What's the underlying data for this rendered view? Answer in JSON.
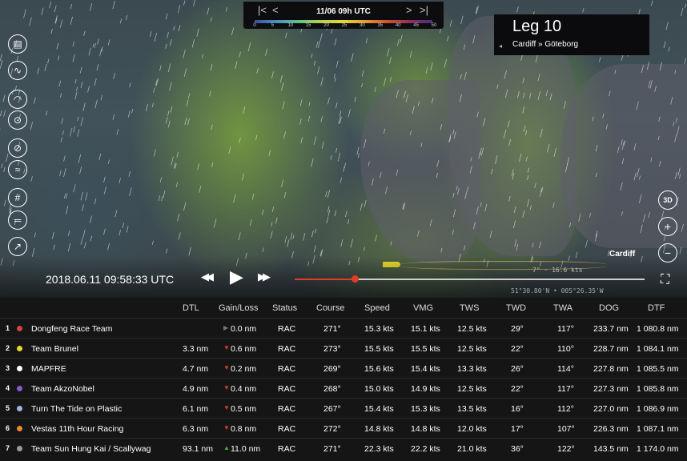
{
  "timebar": {
    "date": "11/06 09h UTC",
    "first": "|<",
    "prev": "<",
    "next": ">",
    "last": ">|",
    "scale": [
      "0",
      "5",
      "10",
      "15",
      "20",
      "25",
      "30",
      "35",
      "40",
      "45",
      "50"
    ]
  },
  "leg": {
    "title": "Leg 10",
    "route": "Cardiff » Göteborg",
    "arrow": "◂"
  },
  "clock": "2018.06.11 09:58:33 UTC",
  "controls": {
    "rewind": "◀◀",
    "play": "▶",
    "forward": "▶▶"
  },
  "map": {
    "cardiff": "Cardiff",
    "boat_info": "7° · 16.6 kts",
    "coords": "51°30.80'N • 005°26.35'W"
  },
  "tools_left": [
    "map-icon",
    "route-icon",
    "wind-icon",
    "compass-icon",
    "current-icon",
    "wave-icon",
    "grid-icon",
    "ruler-icon",
    "graph-icon"
  ],
  "tools_right": {
    "threed": "3D",
    "zoom_in": "+",
    "zoom_out": "−"
  },
  "table": {
    "headers": [
      "DTL",
      "Gain/Loss",
      "Status",
      "Course",
      "Speed",
      "VMG",
      "TWS",
      "TWD",
      "TWA",
      "DOG",
      "DTF"
    ],
    "rows": [
      {
        "rank": "1",
        "color": "#d0463c",
        "team": "Dongfeng Race Team",
        "dtl": "",
        "gain": "0.0 nm",
        "trend": "flat",
        "status": "RAC",
        "course": "271°",
        "speed": "15.3 kts",
        "vmg": "15.1 kts",
        "tws": "12.5 kts",
        "twd": "29°",
        "twa": "117°",
        "dog": "233.7 nm",
        "dtf": "1 080.8 nm"
      },
      {
        "rank": "2",
        "color": "#e8da2c",
        "team": "Team Brunel",
        "dtl": "3.3 nm",
        "gain": "0.6 nm",
        "trend": "down",
        "status": "RAC",
        "course": "273°",
        "speed": "15.5 kts",
        "vmg": "15.5 kts",
        "tws": "12.5 kts",
        "twd": "22°",
        "twa": "110°",
        "dog": "228.7 nm",
        "dtf": "1 084.1 nm"
      },
      {
        "rank": "3",
        "color": "#ffffff",
        "team": "MAPFRE",
        "dtl": "4.7 nm",
        "gain": "0.2 nm",
        "trend": "down",
        "status": "RAC",
        "course": "269°",
        "speed": "15.6 kts",
        "vmg": "15.4 kts",
        "tws": "13.3 kts",
        "twd": "26°",
        "twa": "114°",
        "dog": "227.8 nm",
        "dtf": "1 085.5 nm"
      },
      {
        "rank": "4",
        "color": "#8a5ad0",
        "team": "Team AkzoNobel",
        "dtl": "4.9 nm",
        "gain": "0.4 nm",
        "trend": "down",
        "status": "RAC",
        "course": "268°",
        "speed": "15.0 kts",
        "vmg": "14.9 kts",
        "tws": "12.5 kts",
        "twd": "22°",
        "twa": "117°",
        "dog": "227.3 nm",
        "dtf": "1 085.8 nm"
      },
      {
        "rank": "5",
        "color": "#a0b4e6",
        "team": "Turn The Tide on Plastic",
        "dtl": "6.1 nm",
        "gain": "0.5 nm",
        "trend": "down",
        "status": "RAC",
        "course": "267°",
        "speed": "15.4 kts",
        "vmg": "15.3 kts",
        "tws": "13.5 kts",
        "twd": "16°",
        "twa": "112°",
        "dog": "227.0 nm",
        "dtf": "1 086.9 nm"
      },
      {
        "rank": "6",
        "color": "#e88a30",
        "team": "Vestas 11th Hour Racing",
        "dtl": "6.3 nm",
        "gain": "0.8 nm",
        "trend": "down",
        "status": "RAC",
        "course": "272°",
        "speed": "14.8 kts",
        "vmg": "14.8 kts",
        "tws": "12.0 kts",
        "twd": "17°",
        "twa": "107°",
        "dog": "226.3 nm",
        "dtf": "1 087.1 nm"
      },
      {
        "rank": "7",
        "color": "#9a9a9a",
        "team": "Team Sun Hung Kai / Scallywag",
        "dtl": "93.1 nm",
        "gain": "11.0 nm",
        "trend": "up",
        "status": "RAC",
        "course": "271°",
        "speed": "22.3 kts",
        "vmg": "22.2 kts",
        "tws": "21.0 kts",
        "twd": "36°",
        "twa": "122°",
        "dog": "143.5 nm",
        "dtf": "1 174.0 nm"
      }
    ]
  }
}
